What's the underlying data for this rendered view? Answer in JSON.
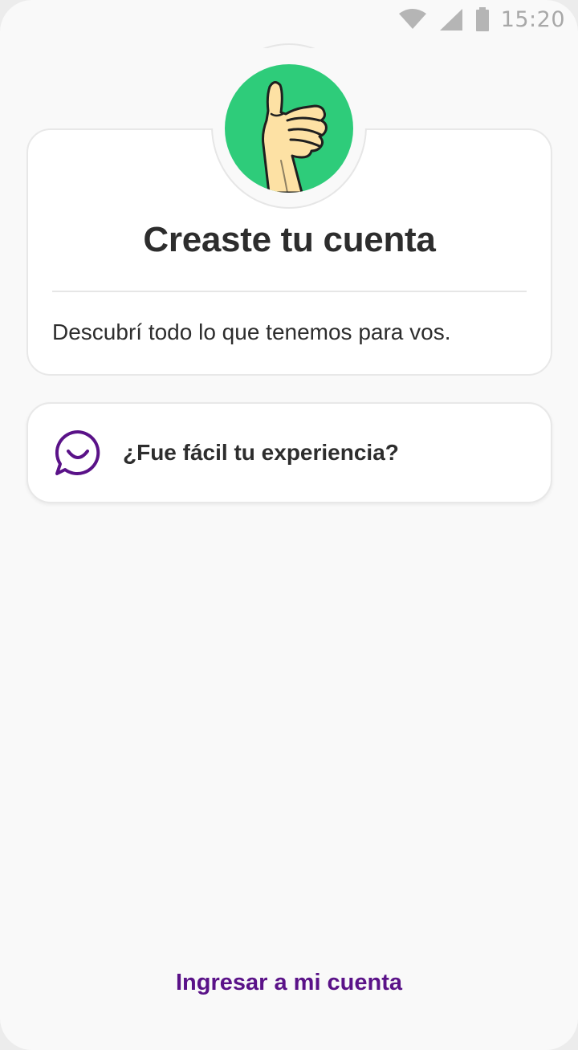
{
  "status_bar": {
    "time": "15:20",
    "icons": [
      "wifi-icon",
      "signal-icon",
      "battery-icon"
    ]
  },
  "success_card": {
    "icon": "thumbs-up-icon",
    "title": "Creaste tu cuenta",
    "message": "Descubrí todo lo que tenemos para vos."
  },
  "feedback_card": {
    "icon": "chat-smile-icon",
    "label": "¿Fue fácil tu experiencia?"
  },
  "footer": {
    "login_link": "Ingresar a mi cuenta"
  },
  "colors": {
    "background": "#f9f9f9",
    "badge_green": "#2ecc7a",
    "accent_purple": "#5a1288",
    "text": "#2d2d2d"
  }
}
